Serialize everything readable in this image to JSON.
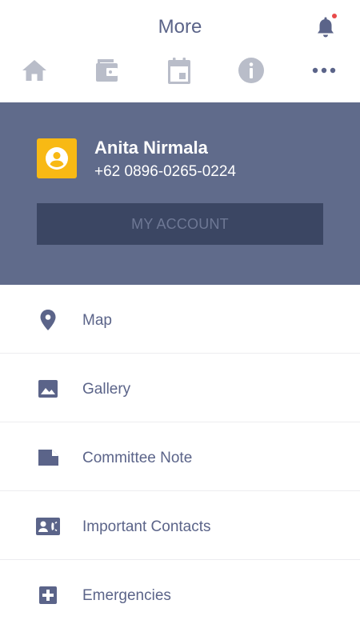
{
  "header": {
    "title": "More"
  },
  "nav": {
    "items": [
      {
        "icon": "home-icon"
      },
      {
        "icon": "wallet-icon"
      },
      {
        "icon": "calendar-icon"
      },
      {
        "icon": "info-icon"
      },
      {
        "icon": "more-dots-icon"
      }
    ],
    "active_index": 4
  },
  "profile": {
    "name": "Anita Nirmala",
    "phone": "+62 0896-0265-0224",
    "account_button_label": "MY ACCOUNT",
    "avatar_color": "#f8b914",
    "background_color": "#606b8b"
  },
  "menu": {
    "items": [
      {
        "label": "Map",
        "icon": "map-pin-icon"
      },
      {
        "label": "Gallery",
        "icon": "image-icon"
      },
      {
        "label": "Committee Note",
        "icon": "note-icon"
      },
      {
        "label": "Important Contacts",
        "icon": "contacts-icon"
      },
      {
        "label": "Emergencies",
        "icon": "medical-cross-icon"
      }
    ]
  },
  "colors": {
    "accent": "#5b6489",
    "inactive_icon": "#b9bdc9",
    "notification_dot": "#e84a4a"
  }
}
